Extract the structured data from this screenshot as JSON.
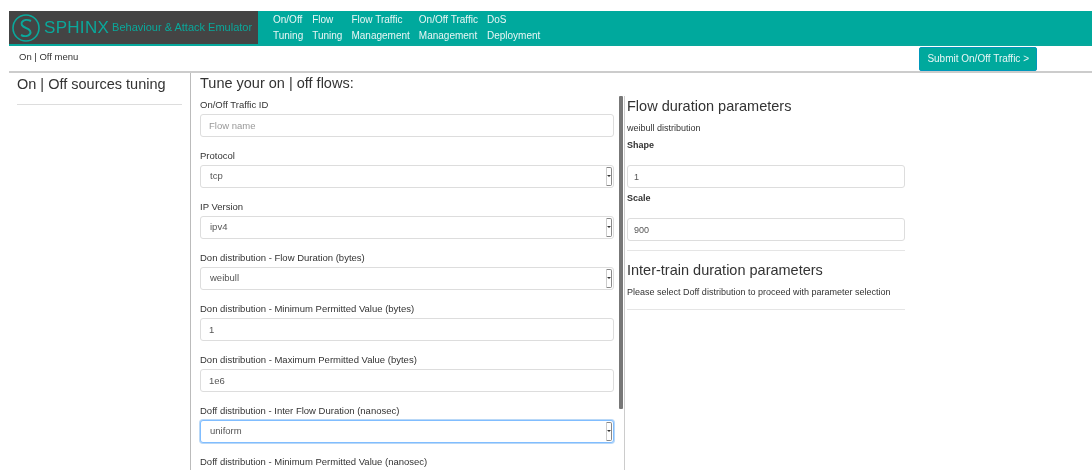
{
  "brand": {
    "logo_text": "SPHINX",
    "subtitle": "Behaviour & Attack Emulator"
  },
  "nav": [
    {
      "lines": [
        "On/Off",
        "Tuning"
      ]
    },
    {
      "lines": [
        "Flow",
        "Tuning"
      ]
    },
    {
      "lines": [
        "Flow Traffic",
        "Management"
      ]
    },
    {
      "lines": [
        "On/Off Traffic",
        "Management"
      ]
    },
    {
      "lines": [
        "DoS",
        "Deployment"
      ]
    }
  ],
  "submenu": {
    "title": "On | Off menu",
    "button": "Submit On/Off Traffic >"
  },
  "sidebar": {
    "title": "On | Off sources tuning"
  },
  "form": {
    "title": "Tune your on | off flows:",
    "fields": [
      {
        "label": "On/Off Traffic ID",
        "kind": "input",
        "placeholder": "Flow name",
        "focused": false
      },
      {
        "label": "Protocol",
        "kind": "select",
        "value": "tcp",
        "focused": false
      },
      {
        "label": "IP Version",
        "kind": "select",
        "value": "ipv4",
        "focused": false
      },
      {
        "label": "Don distribution - Flow Duration (bytes)",
        "kind": "select",
        "value": "weibull",
        "focused": false
      },
      {
        "label": "Don distribution - Minimum Permitted Value (bytes)",
        "kind": "input",
        "value": "1",
        "focused": false
      },
      {
        "label": "Don distribution - Maximum Permitted Value (bytes)",
        "kind": "input",
        "value": "1e6",
        "focused": false
      },
      {
        "label": "Doff distribution - Inter Flow Duration (nanosec)",
        "kind": "select",
        "value": "uniform",
        "focused": true
      },
      {
        "label": "Doff distribution - Minimum Permitted Value (nanosec)",
        "kind": "label"
      }
    ]
  },
  "flow_duration": {
    "title": "Flow duration parameters",
    "subtitle": "weibull distribution",
    "params": [
      {
        "label": "Shape",
        "value": "1"
      },
      {
        "label": "Scale",
        "value": "900"
      }
    ]
  },
  "inter_train": {
    "title": "Inter-train duration parameters",
    "message": "Please select Doff distribution to proceed with parameter selection"
  }
}
